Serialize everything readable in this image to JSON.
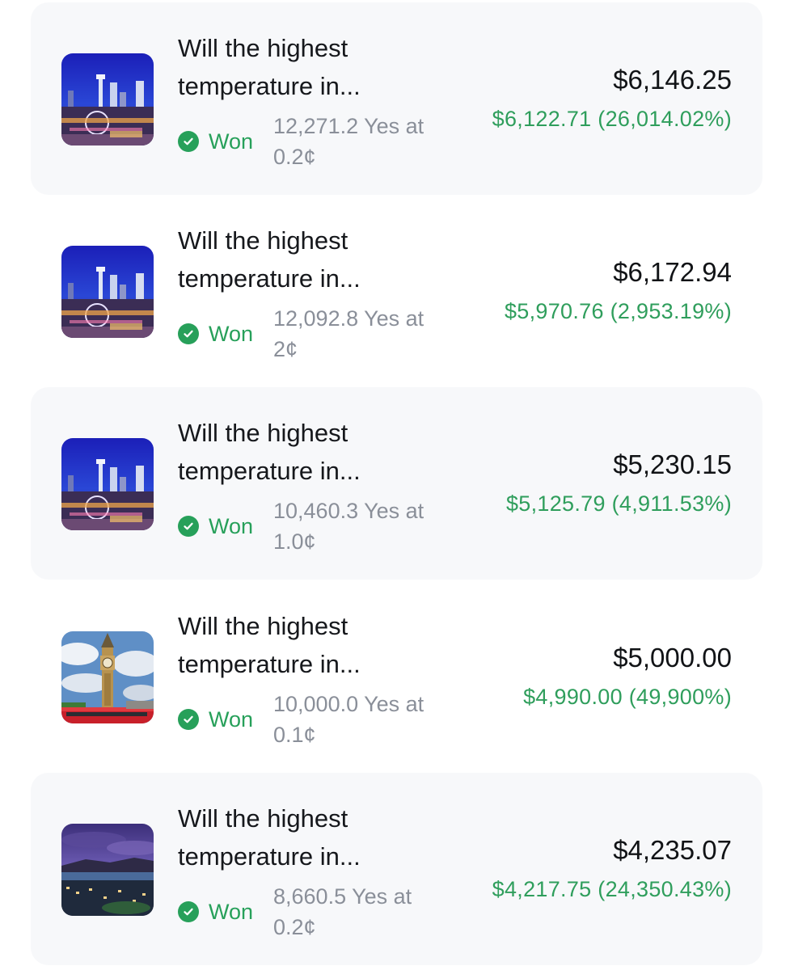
{
  "status_color": "#27a05a",
  "positions": [
    {
      "image": "city-skyline-night-thumbnail",
      "title_line1": "Will the highest",
      "title_line2": "temperature in...",
      "status": "Won",
      "shares_line1": "12,271.2 Yes at",
      "shares_line2": "0.2¢",
      "value": "$6,146.25",
      "pnl": "$6,122.71 (26,014.02%)"
    },
    {
      "image": "city-skyline-night-thumbnail",
      "title_line1": "Will the highest",
      "title_line2": "temperature in...",
      "status": "Won",
      "shares_line1": "12,092.8 Yes at",
      "shares_line2": "2¢",
      "value": "$6,172.94",
      "pnl": "$5,970.76 (2,953.19%)"
    },
    {
      "image": "city-skyline-night-thumbnail",
      "title_line1": "Will the highest",
      "title_line2": "temperature in...",
      "status": "Won",
      "shares_line1": "10,460.3 Yes at",
      "shares_line2": "1.0¢",
      "value": "$5,230.15",
      "pnl": "$5,125.79 (4,911.53%)"
    },
    {
      "image": "clock-tower-thumbnail",
      "title_line1": "Will the highest",
      "title_line2": "temperature in...",
      "status": "Won",
      "shares_line1": "10,000.0 Yes at",
      "shares_line2": "0.1¢",
      "value": "$5,000.00",
      "pnl": "$4,990.00 (49,900%)"
    },
    {
      "image": "coastal-city-dusk-thumbnail",
      "title_line1": "Will the highest",
      "title_line2": "temperature in...",
      "status": "Won",
      "shares_line1": "8,660.5 Yes at",
      "shares_line2": "0.2¢",
      "value": "$4,235.07",
      "pnl": "$4,217.75 (24,350.43%)"
    }
  ]
}
